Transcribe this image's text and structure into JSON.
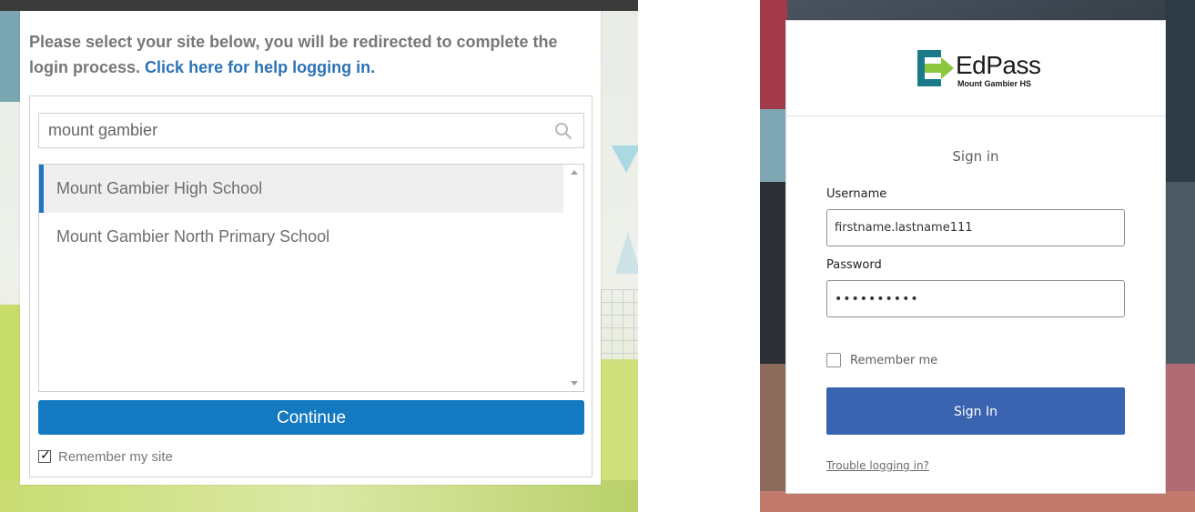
{
  "site_selector": {
    "intro_text": "Please select your site below, you will be redirected to complete the login process.",
    "help_link": "Click here for help logging in.",
    "search": {
      "value": "mount gambier",
      "placeholder": ""
    },
    "results": [
      {
        "label": "Mount Gambier High School",
        "selected": true
      },
      {
        "label": "Mount Gambier North Primary School",
        "selected": false
      }
    ],
    "continue_label": "Continue",
    "remember_label": "Remember my site",
    "remember_checked": true
  },
  "login": {
    "logo": {
      "name": "EdPass",
      "subtitle": "Mount Gambier HS"
    },
    "title": "Sign in",
    "username_label": "Username",
    "username_value": "firstname.lastname111",
    "password_label": "Password",
    "password_value": "••••••••••",
    "remember_label": "Remember me",
    "remember_checked": false,
    "signin_label": "Sign In",
    "trouble_link": "Trouble logging in?"
  },
  "colors": {
    "continue_blue": "#1379c0",
    "link_blue": "#2c72b6",
    "signin_blue": "#3a63b0",
    "logo_teal": "#1b7a8a",
    "logo_green": "#8cc63f"
  },
  "icons": [
    "search-icon",
    "edpass-logo-icon",
    "checkmark-icon",
    "scroll-up-icon",
    "scroll-down-icon"
  ]
}
